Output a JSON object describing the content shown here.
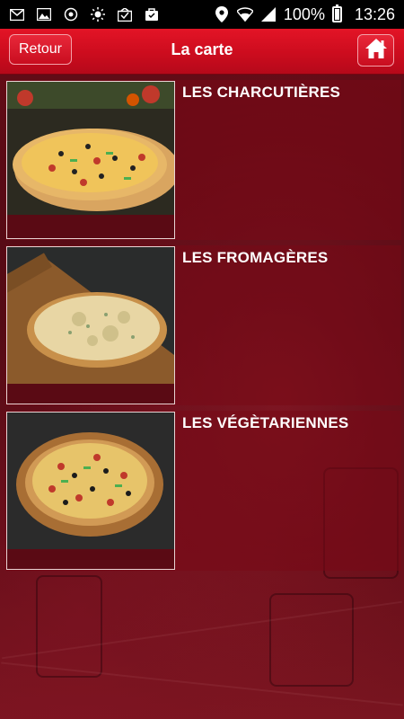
{
  "status_bar": {
    "icons_left": [
      "gmail-icon",
      "photo-icon",
      "sync-icon",
      "brightness-icon",
      "download-photo-icon",
      "bag-icon"
    ],
    "icons_right": [
      "location-icon",
      "wifi-icon",
      "signal-icon"
    ],
    "battery": "100%",
    "battery_level": 1.0,
    "time": "13:26"
  },
  "header": {
    "back_label": "Retour",
    "title": "La carte",
    "home_icon": "home-icon",
    "accent": "#d90f22"
  },
  "menu": {
    "items": [
      {
        "label": "LES CHARCUTIÈRES"
      },
      {
        "label": "LES FROMAGÈRES"
      },
      {
        "label": "LES VÉGÈTARIENNES"
      }
    ]
  }
}
